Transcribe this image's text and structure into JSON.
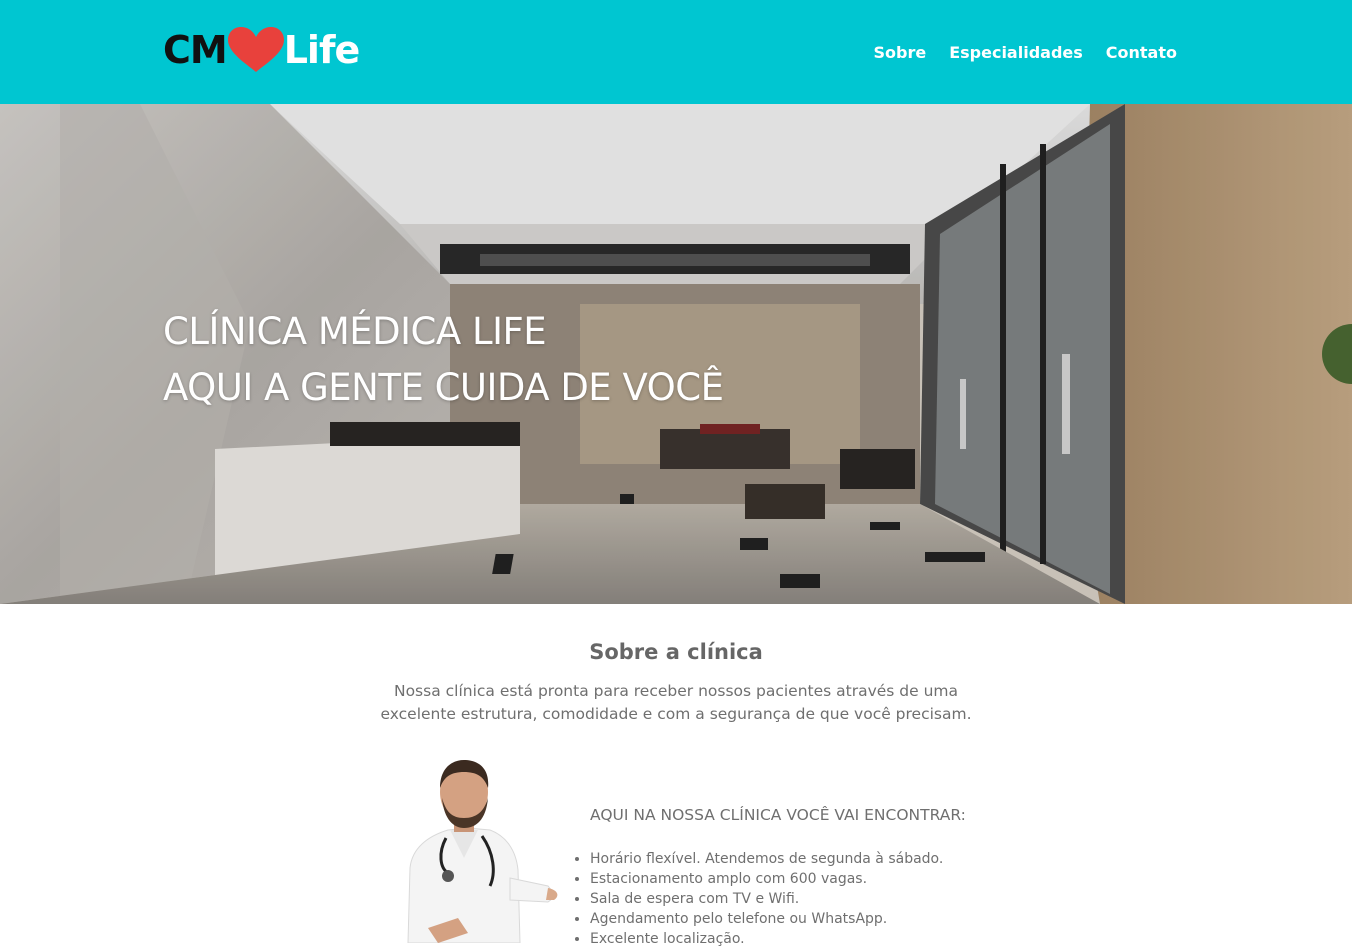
{
  "header": {
    "logo_left": "CM",
    "logo_right": "Life",
    "nav": [
      "Sobre",
      "Especialidades",
      "Contato"
    ],
    "background_color": "#00c6d1",
    "heart_color": "#e8413c"
  },
  "hero": {
    "line1": "CLÍNICA MÉDICA LIFE",
    "line2": "AQUI A GENTE CUIDA DE VOCÊ"
  },
  "about": {
    "title": "Sobre a clínica",
    "text": "Nossa clínica está pronta para receber nossos pacientes através de uma excelente estrutura, comodidade e com a segurança de que você precisam.",
    "features_title": "AQUI NA NOSSA CLÍNICA VOCÊ VAI ENCONTRAR:",
    "features": [
      "Horário flexível. Atendemos de segunda à sábado.",
      "Estacionamento amplo com 600 vagas.",
      "Sala de espera com TV e Wifi.",
      "Agendamento pelo telefone ou WhatsApp.",
      "Excelente localização."
    ]
  }
}
